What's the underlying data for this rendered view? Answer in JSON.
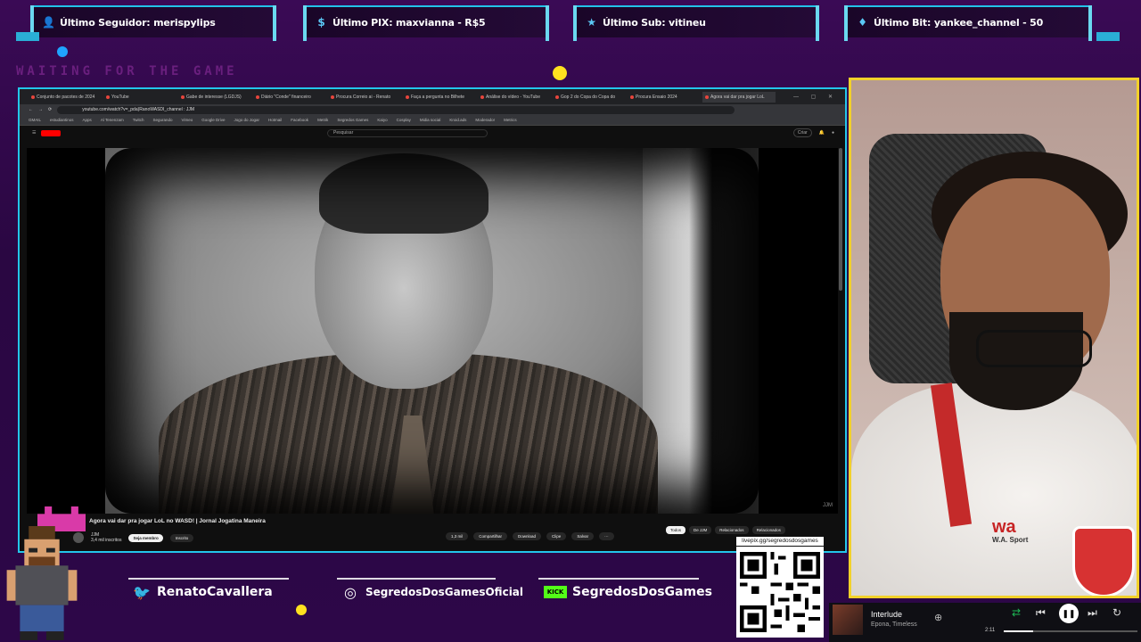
{
  "alerts": [
    {
      "icon": "user-icon",
      "label": "Último Seguidor: merispylips"
    },
    {
      "icon": "dollar-icon",
      "label": "Último PIX: maxvianna - R$5"
    },
    {
      "icon": "star-icon",
      "label": "Último Sub: vitineu"
    },
    {
      "icon": "diamond-icon",
      "label": "Último Bit: yankee_channel - 50"
    }
  ],
  "waiting_text": "WAITING FOR THE GAME",
  "browser": {
    "tabs": [
      "Conjunto de pacotes de 2024",
      "YouTube",
      "Gabe de interesse (LGDJS)",
      "Diário \"Conde\" financeiro",
      "Procura Correio ai - Renato",
      "Faça a pergunta no Bilhete",
      "Análise do vídeo - YouTube",
      "Gop 2 do Copa do Copa do",
      "Procura Ensaio 2024",
      "Agora vai dar pra jogar LoL"
    ],
    "url": "youtube.com/watch?v=_pda)RanoWASDI_channel : JJM",
    "bookmarks": [
      "GMAIL",
      "estudiantinos",
      "Apps",
      "Al Tenenzam",
      "Twitch",
      "Segurando",
      "Vimeo",
      "Google Drive",
      "Jogo do Jogar",
      "Hotmail",
      "Facebook",
      "Metrik",
      "Segredos Games",
      "Kaiyo",
      "Cosplay",
      "Midia social",
      "Kroid.ads",
      "Moderador",
      "Metrics"
    ],
    "search_placeholder": "Pesquisar",
    "create_label": "Criar",
    "video_title": "Agora vai dar pra jogar LoL no WASD! | Jornal Jogatina Maneira",
    "watermark": "JJM",
    "channel_name": "JJM",
    "channel_subs": "3,4 mil inscritos",
    "member_label": "Seja membro",
    "subscribe_label": "Inscrito",
    "actions": [
      "1,3 mil",
      "Compartilhar",
      "Download",
      "Clipe",
      "Salvar",
      "···"
    ],
    "chips": [
      "Todos",
      "De JJM",
      "Relacionados",
      "Relacionados"
    ]
  },
  "social": [
    {
      "icon": "twitter-icon",
      "label": "RenatoCavallera"
    },
    {
      "icon": "instagram-icon",
      "label": "SegredosDosGamesOficial"
    },
    {
      "icon": "kick-icon",
      "label": "SegredosDosGames"
    }
  ],
  "qr_label": "livepix.gg/segredosdosgames",
  "player": {
    "track": "Interlude",
    "artist": "Epona, Timeless",
    "time": "2:11",
    "progress": 0.22
  },
  "colors": {
    "accent": "#23c6ea",
    "webcam_border": "#f2d12a",
    "background": "#2d0748"
  }
}
